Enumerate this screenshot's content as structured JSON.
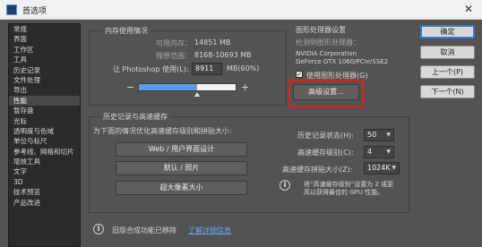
{
  "window": {
    "title": "首选项",
    "close_glyph": "✕"
  },
  "sidebar": {
    "items": [
      {
        "label": "常规"
      },
      {
        "label": "界面"
      },
      {
        "label": "工作区"
      },
      {
        "label": "工具"
      },
      {
        "label": "历史记录"
      },
      {
        "label": "文件处理"
      },
      {
        "label": "导出"
      },
      {
        "label": "性能"
      },
      {
        "label": "暂存盘"
      },
      {
        "label": "光标"
      },
      {
        "label": "透明度与色域"
      },
      {
        "label": "单位与标尺"
      },
      {
        "label": "参考线、网格和切片"
      },
      {
        "label": "增效工具"
      },
      {
        "label": "文字"
      },
      {
        "label": "3D"
      },
      {
        "label": "技术预览"
      },
      {
        "label": "产品改进"
      }
    ],
    "active_index": 7
  },
  "memory": {
    "title": "内存使用情况",
    "available_label": "可用内存：",
    "available_value": "14851 MB",
    "ideal_label": "理想范围：",
    "ideal_value": "8168-10693 MB",
    "let_label": "让 Photoshop 使用(L):",
    "let_value": "8911",
    "let_suffix": "MB(60%)",
    "minus": "−",
    "plus": "+",
    "slider_fraction": 0.6
  },
  "gpu": {
    "title": "图形处理器设置",
    "detected_label": "检测到图形处理器：",
    "vendor": "NVIDIA Corporation",
    "model": "GeForce GTX 1060/PCIe/SSE2",
    "use_gpu_label": "使用图形处理器(G)",
    "use_gpu_checked": true,
    "checkmark": "✓",
    "advanced_button": "高级设置..."
  },
  "history_cache": {
    "title": "历史记录与高速缓存",
    "optimize_label": "为下面的情况优化高速缓存级别和拼贴大小:",
    "presets": [
      "Web / 用户界面设计",
      "默认 / 照片",
      "超大像素大小"
    ],
    "history_states_label": "历史记录状态(H):",
    "history_states_value": "50",
    "cache_levels_label": "高速缓存级别(C):",
    "cache_levels_value": "4",
    "tile_size_label": "高速缓存拼贴大小(Z):",
    "tile_size_value": "1024K",
    "dropdown_glyph": "▼",
    "note_line1": "将“高速缓存级别”设置为 2 或更",
    "note_line2": "高以获得最佳的 GPU 性能。"
  },
  "footer": {
    "info_glyph": "i",
    "removed_text": "旧版合成功能已移除",
    "learn_more": "了解详细信息"
  },
  "buttons": {
    "ok": "确定",
    "cancel": "取消",
    "prev": "上一个(P)",
    "next": "下一个(N)"
  }
}
